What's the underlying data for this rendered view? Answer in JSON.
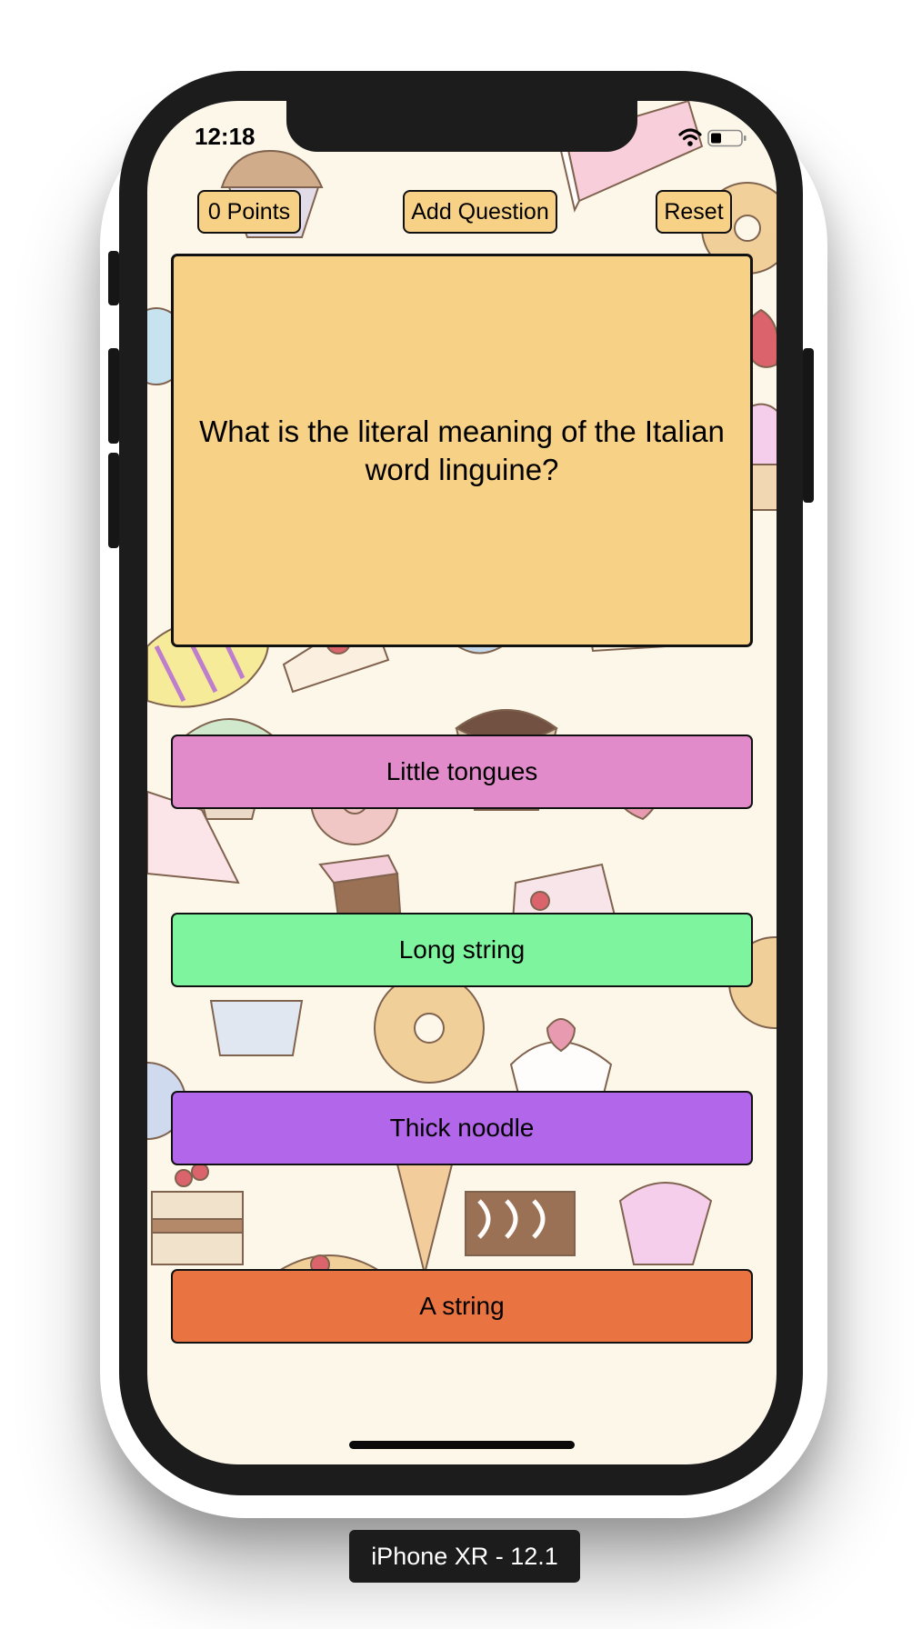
{
  "status_bar": {
    "time": "12:18",
    "icons": [
      "wifi-icon",
      "battery-icon"
    ]
  },
  "toolbar": {
    "points_label": "0 Points",
    "add_question_label": "Add Question",
    "reset_label": "Reset"
  },
  "question": {
    "text": "What is the literal meaning of the Italian word linguine?"
  },
  "answers": [
    {
      "label": "Little tongues",
      "color": "#e28bca"
    },
    {
      "label": "Long string",
      "color": "#7ff49e"
    },
    {
      "label": "Thick noodle",
      "color": "#b266ea"
    },
    {
      "label": "A string",
      "color": "#e97341"
    }
  ],
  "device_label": "iPhone XR - 12.1",
  "colors": {
    "button_bg": "#f7d186",
    "question_bg": "#f7d286",
    "device_frame": "#1c1c1d",
    "pattern_bg": "#fdf7ea"
  }
}
